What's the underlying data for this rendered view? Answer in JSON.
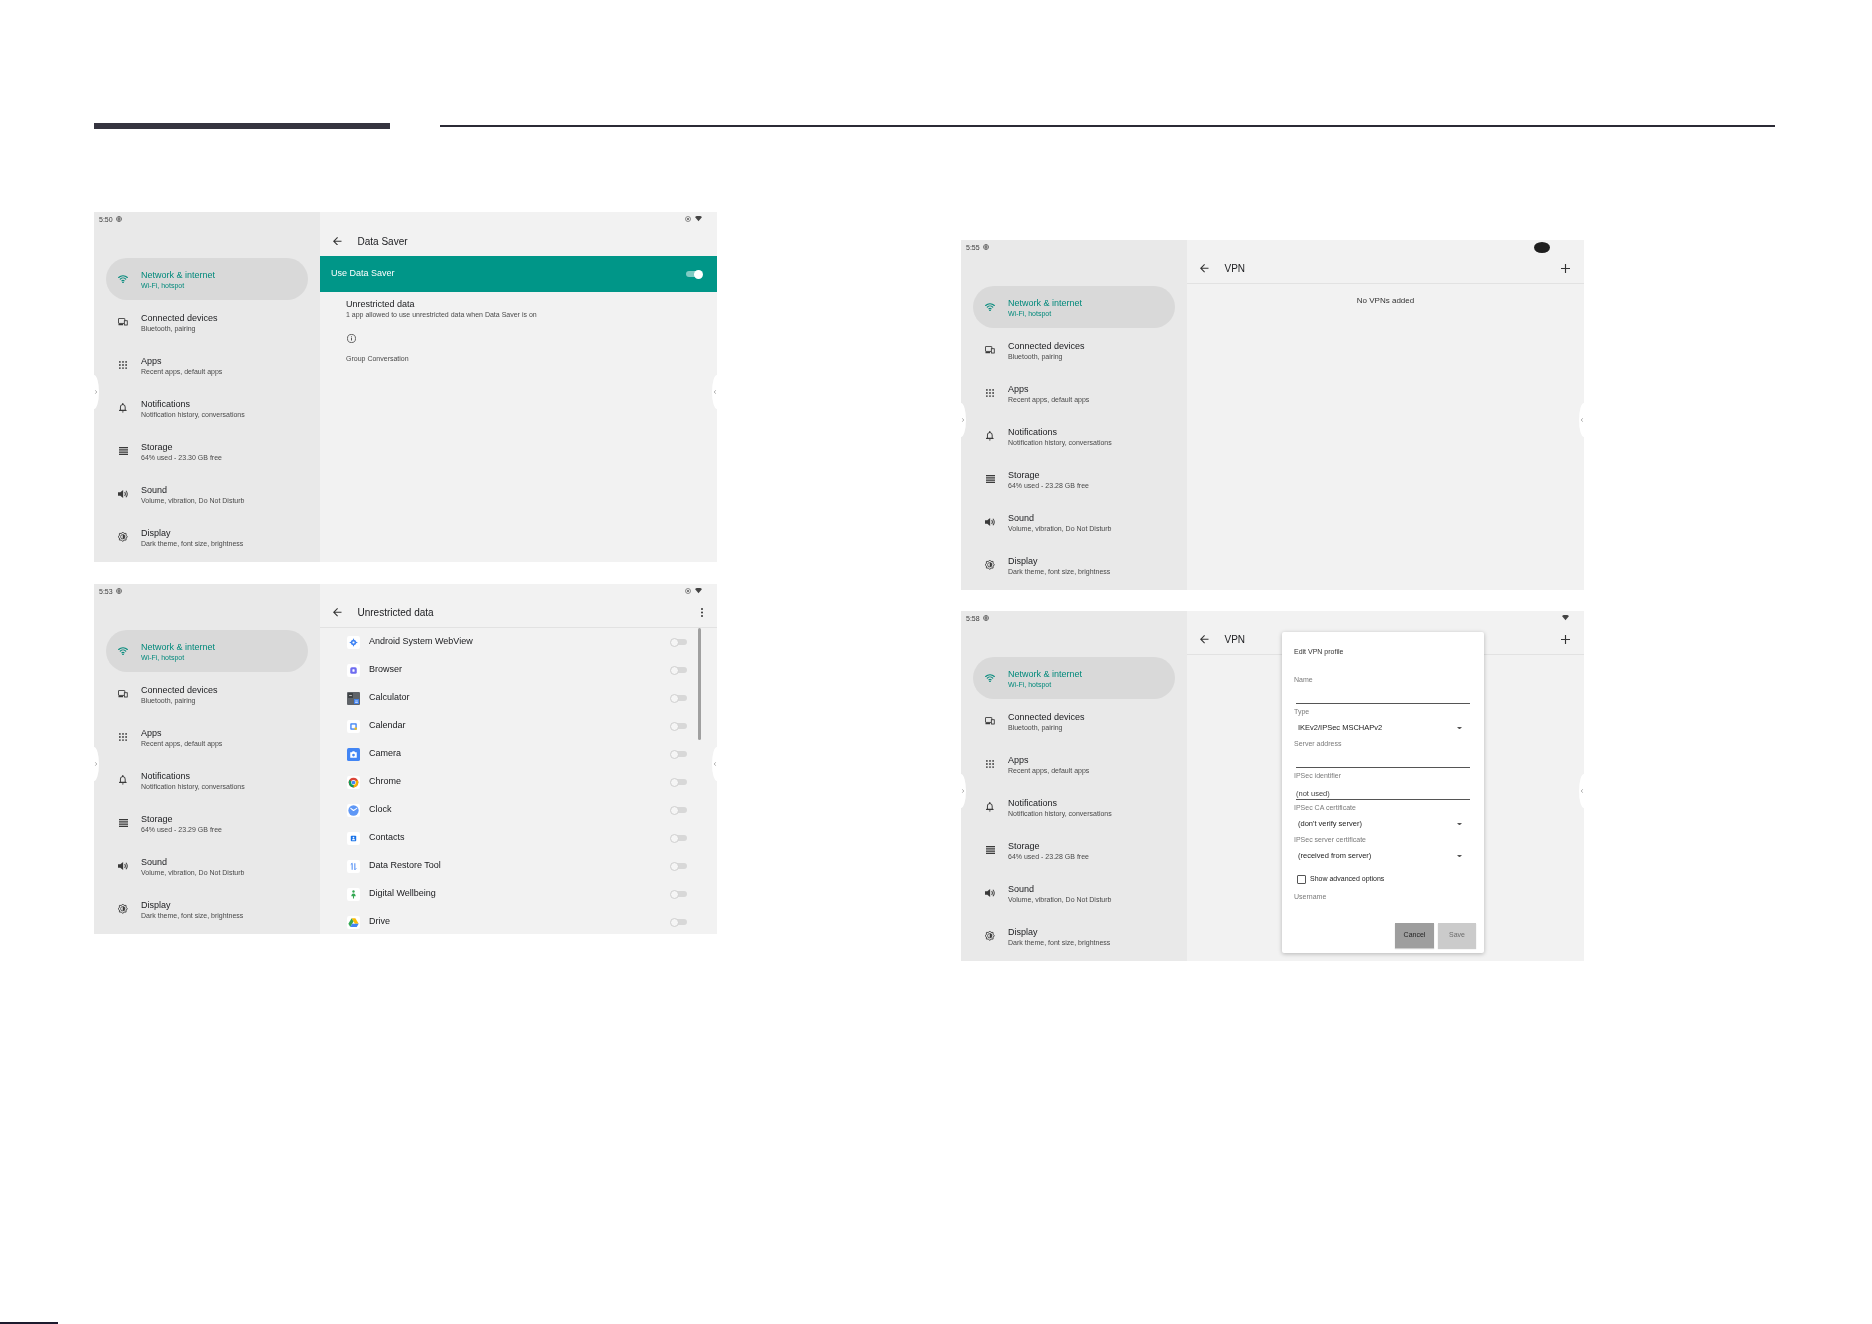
{
  "left_column": {
    "screens": [
      {
        "status_bar": {
          "time": "5:50",
          "icons": [
            {
              "kind": "ring"
            },
            {
              "kind": "wifi"
            }
          ]
        },
        "sidebar": {
          "items": [
            {
              "title": "Network & internet",
              "subtitle": "Wi-Fi, hotspot",
              "selected": true
            },
            {
              "title": "Connected devices",
              "subtitle": "Bluetooth, pairing",
              "selected": false
            },
            {
              "title": "Apps",
              "subtitle": "Recent apps, default apps",
              "selected": false
            },
            {
              "title": "Notifications",
              "subtitle": "Notification history, conversations",
              "selected": false
            },
            {
              "title": "Storage",
              "subtitle": "64% used - 23.30 GB free",
              "selected": false
            },
            {
              "title": "Sound",
              "subtitle": "Volume, vibration, Do Not Disturb",
              "selected": false
            },
            {
              "title": "Display",
              "subtitle": "Dark theme, font size, brightness",
              "selected": false
            }
          ]
        },
        "page": {
          "kind": "data_saver",
          "title": "Data Saver",
          "switch": {
            "label": "Use Data Saver",
            "on": true
          },
          "item": {
            "title": "Unrestricted data",
            "subtitle": "1 app allowed to use unrestricted data when Data Saver is on"
          },
          "note": "Group Conversation"
        }
      },
      {
        "status_bar": {
          "time": "5:53",
          "icons": [
            {
              "kind": "ring"
            },
            {
              "kind": "wifi"
            }
          ]
        },
        "sidebar": {
          "items": [
            {
              "title": "Network & internet",
              "subtitle": "Wi-Fi, hotspot",
              "selected": true
            },
            {
              "title": "Connected devices",
              "subtitle": "Bluetooth, pairing",
              "selected": false
            },
            {
              "title": "Apps",
              "subtitle": "Recent apps, default apps",
              "selected": false
            },
            {
              "title": "Notifications",
              "subtitle": "Notification history, conversations",
              "selected": false
            },
            {
              "title": "Storage",
              "subtitle": "64% used - 23.29 GB free",
              "selected": false
            },
            {
              "title": "Sound",
              "subtitle": "Volume, vibration, Do Not Disturb",
              "selected": false
            },
            {
              "title": "Display",
              "subtitle": "Dark theme, font size, brightness",
              "selected": false
            }
          ]
        },
        "page": {
          "kind": "app_list",
          "title": "Unrestricted data",
          "apps": [
            {
              "name": "Android System WebView",
              "on": false
            },
            {
              "name": "Browser",
              "on": false
            },
            {
              "name": "Calculator",
              "on": false
            },
            {
              "name": "Calendar",
              "on": false
            },
            {
              "name": "Camera",
              "on": false
            },
            {
              "name": "Chrome",
              "on": false
            },
            {
              "name": "Clock",
              "on": false
            },
            {
              "name": "Contacts",
              "on": false
            },
            {
              "name": "Data Restore Tool",
              "on": false
            },
            {
              "name": "Digital Wellbeing",
              "on": false
            },
            {
              "name": "Drive",
              "on": false
            }
          ]
        }
      }
    ]
  },
  "right_column": {
    "screens": [
      {
        "status_bar": {
          "time": "5:55",
          "icons": [
            {
              "kind": "blob"
            }
          ]
        },
        "sidebar": {
          "items": [
            {
              "title": "Network & internet",
              "subtitle": "Wi-Fi, hotspot",
              "selected": true
            },
            {
              "title": "Connected devices",
              "subtitle": "Bluetooth, pairing",
              "selected": false
            },
            {
              "title": "Apps",
              "subtitle": "Recent apps, default apps",
              "selected": false
            },
            {
              "title": "Notifications",
              "subtitle": "Notification history, conversations",
              "selected": false
            },
            {
              "title": "Storage",
              "subtitle": "64% used - 23.28 GB free",
              "selected": false
            },
            {
              "title": "Sound",
              "subtitle": "Volume, vibration, Do Not Disturb",
              "selected": false
            },
            {
              "title": "Display",
              "subtitle": "Dark theme, font size, brightness",
              "selected": false
            }
          ]
        },
        "page": {
          "kind": "vpn",
          "title": "VPN",
          "empty_text": "No VPNs added"
        }
      },
      {
        "status_bar": {
          "time": "5:58",
          "icons": [
            {
              "kind": "wifi"
            }
          ]
        },
        "sidebar": {
          "items": [
            {
              "title": "Network & internet",
              "subtitle": "Wi-Fi, hotspot",
              "selected": true
            },
            {
              "title": "Connected devices",
              "subtitle": "Bluetooth, pairing",
              "selected": false
            },
            {
              "title": "Apps",
              "subtitle": "Recent apps, default apps",
              "selected": false
            },
            {
              "title": "Notifications",
              "subtitle": "Notification history, conversations",
              "selected": false
            },
            {
              "title": "Storage",
              "subtitle": "64% used - 23.28 GB free",
              "selected": false
            },
            {
              "title": "Sound",
              "subtitle": "Volume, vibration, Do Not Disturb",
              "selected": false
            },
            {
              "title": "Display",
              "subtitle": "Dark theme, font size, brightness",
              "selected": false
            }
          ]
        },
        "page": {
          "kind": "vpn",
          "title": "VPN",
          "dialog": {
            "title": "Edit VPN profile",
            "fields": [
              {
                "kind": "text",
                "label": "Name"
              },
              {
                "kind": "dropdown",
                "label": "Type",
                "value": "IKEv2/IPSec MSCHAPv2"
              },
              {
                "kind": "text",
                "label": "Server address"
              },
              {
                "kind": "text",
                "label": "IPSec identifier",
                "placeholder": "(not used)"
              },
              {
                "kind": "dropdown",
                "label": "IPSec CA certificate",
                "value": "(don't verify server)"
              },
              {
                "kind": "dropdown",
                "label": "IPSec server certificate",
                "value": "(received from server)"
              },
              {
                "kind": "checkbox",
                "label": "Show advanced options",
                "checked": false
              },
              {
                "kind": "label",
                "label": "Username"
              }
            ],
            "buttons": [
              {
                "label": "Cancel",
                "disabled": false
              },
              {
                "label": "Save",
                "disabled": true
              }
            ]
          }
        }
      }
    ]
  }
}
